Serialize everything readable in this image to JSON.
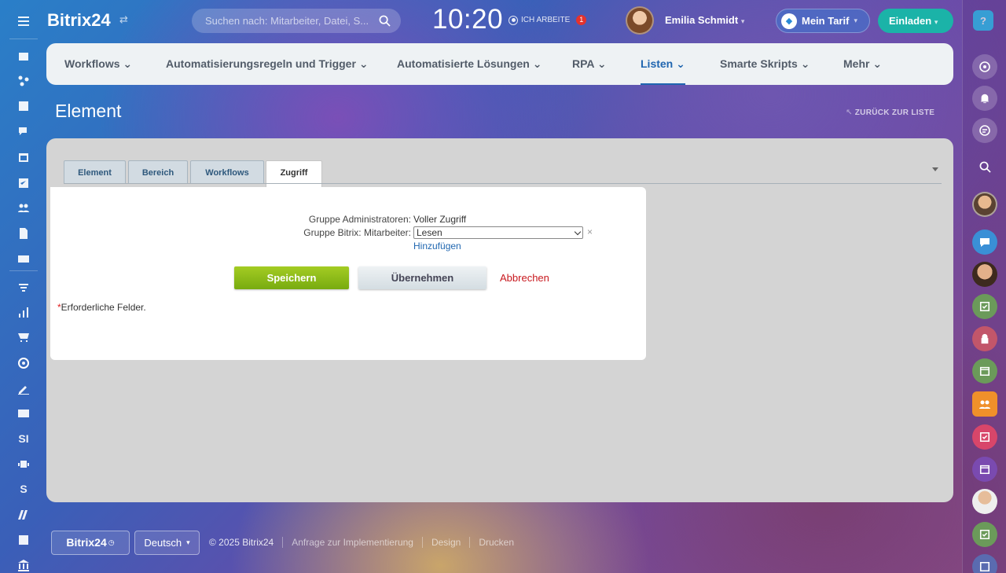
{
  "app": {
    "logo": "Bitrix24"
  },
  "search": {
    "placeholder": "Suchen nach: Mitarbeiter, Datei, S..."
  },
  "clock": {
    "time": "10:20",
    "status": "ICH ARBEITE",
    "badge": "1"
  },
  "user": {
    "name": "Emilia Schmidt"
  },
  "tarif": {
    "label": "Mein Tarif"
  },
  "invite": {
    "label": "Einladen"
  },
  "help": {
    "label": "?"
  },
  "left_sidebar": {
    "text_items": [
      "SI",
      "S"
    ]
  },
  "nav": {
    "items": [
      {
        "label": "Workflows"
      },
      {
        "label": "Automatisierungsregeln und Trigger"
      },
      {
        "label": "Automatisierte Lösungen"
      },
      {
        "label": "RPA"
      },
      {
        "label": "Listen"
      },
      {
        "label": "Smarte Skripts"
      },
      {
        "label": "Mehr"
      }
    ],
    "active": "Listen"
  },
  "page": {
    "title": "Element",
    "back": "ZURÜCK ZUR LISTE"
  },
  "tabs": [
    {
      "label": "Element"
    },
    {
      "label": "Bereich"
    },
    {
      "label": "Workflows"
    },
    {
      "label": "Zugriff"
    }
  ],
  "form": {
    "row1_label": "Gruppe Administratoren:",
    "row1_value": "Voller Zugriff",
    "row2_label": "Gruppe Bitrix: Mitarbeiter:",
    "row2_select": "Lesen",
    "delete": "×",
    "add": "Hinzufügen",
    "save": "Speichern",
    "apply": "Übernehmen",
    "cancel": "Abbrechen",
    "required_star": "*",
    "required_note": "Erforderliche Felder."
  },
  "footer": {
    "logo": "Bitrix24",
    "lang": "Deutsch",
    "copyright": "© 2025 Bitrix24",
    "links": [
      "Anfrage zur Implementierung",
      "Design",
      "Drucken"
    ]
  },
  "colors": {
    "accent": "#2066b0",
    "save": "#8dbc19",
    "cancel": "#c8181e",
    "invite": "#1bb3a8"
  }
}
